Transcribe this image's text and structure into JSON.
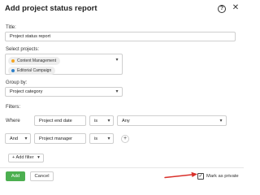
{
  "dialog": {
    "title": "Add project status report",
    "help_icon": "?",
    "close_icon": "✕"
  },
  "form": {
    "title_label": "Title:",
    "title_value": "Project status report",
    "projects_label": "Select projects:",
    "projects": [
      {
        "label": "Content Management",
        "color": "#f5a623"
      },
      {
        "label": "Editorial Campaign",
        "color": "#2f80c9"
      }
    ],
    "group_by_label": "Group by:",
    "group_by_value": "Project category",
    "filters_label": "Filters:",
    "filters": [
      {
        "connector": "Where",
        "field": "Project end date",
        "operator": "is",
        "value": "Any"
      },
      {
        "connector": "And",
        "field": "Project manager",
        "operator": "is",
        "value": ""
      }
    ],
    "add_filter_label": "+ Add filter",
    "plus_icon": "+"
  },
  "footer": {
    "add_label": "Add",
    "cancel_label": "Cancel",
    "checkbox_checked": true,
    "checkbox_mark": "✓",
    "mark_private_label": "Mark as private"
  },
  "colors": {
    "primary": "#4caf50",
    "arrow": "#d9302a"
  },
  "icons": {
    "chevron": "▾"
  }
}
